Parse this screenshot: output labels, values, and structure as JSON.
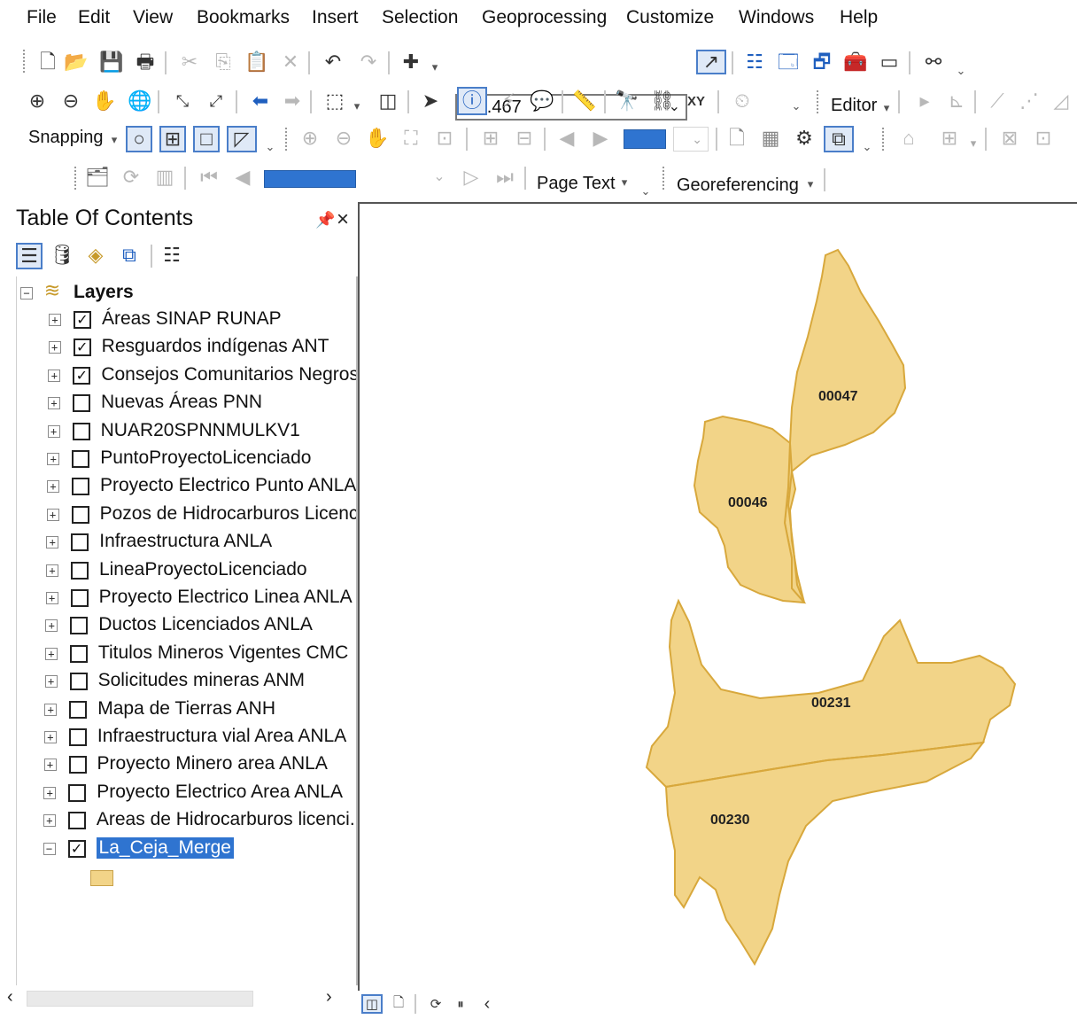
{
  "menu": [
    "File",
    "Edit",
    "View",
    "Bookmarks",
    "Insert",
    "Selection",
    "Geoprocessing",
    "Customize",
    "Windows",
    "Help"
  ],
  "toolbar": {
    "scale_value": "1:8.467",
    "editor_label": "Editor",
    "snapping_label": "Snapping",
    "page_text_label": "Page Text",
    "georeferencing_label": "Georeferencing",
    "dropdown_arrow": "▾"
  },
  "toc": {
    "title": "Table Of Contents",
    "root_label": "Layers",
    "layers": [
      {
        "label": "Áreas SINAP RUNAP",
        "checked": true
      },
      {
        "label": "Resguardos indígenas ANT",
        "checked": true
      },
      {
        "label": "Consejos Comunitarios Negros",
        "checked": true
      },
      {
        "label": "Nuevas Áreas PNN",
        "checked": false
      },
      {
        "label": "NUAR20SPNNMULKV1",
        "checked": false
      },
      {
        "label": "PuntoProyectoLicenciado",
        "checked": false
      },
      {
        "label": "Proyecto Electrico Punto ANLA",
        "checked": false
      },
      {
        "label": "Pozos de Hidrocarburos Licenc",
        "checked": false
      },
      {
        "label": "Infraestructura ANLA",
        "checked": false
      },
      {
        "label": "LineaProyectoLicenciado",
        "checked": false
      },
      {
        "label": "Proyecto Electrico Linea ANLA",
        "checked": false
      },
      {
        "label": "Ductos Licenciados ANLA",
        "checked": false
      },
      {
        "label": "Titulos Mineros Vigentes CMC",
        "checked": false
      },
      {
        "label": "Solicitudes mineras ANM",
        "checked": false
      },
      {
        "label": "Mapa de Tierras ANH",
        "checked": false
      },
      {
        "label": "Infraestructura vial Area ANLA",
        "checked": false
      },
      {
        "label": "Proyecto Minero area ANLA",
        "checked": false
      },
      {
        "label": "Proyecto Electrico Area ANLA",
        "checked": false
      },
      {
        "label": "Areas de Hidrocarburos licenci.",
        "checked": false
      },
      {
        "label": "La_Ceja_Merge",
        "checked": true,
        "selected": true,
        "expanded": true
      }
    ]
  },
  "map": {
    "parcels": [
      {
        "id": "00047"
      },
      {
        "id": "00046"
      },
      {
        "id": "00231"
      },
      {
        "id": "00230"
      }
    ],
    "fill_color": "#f2d488",
    "stroke_color": "#d8a83c"
  }
}
